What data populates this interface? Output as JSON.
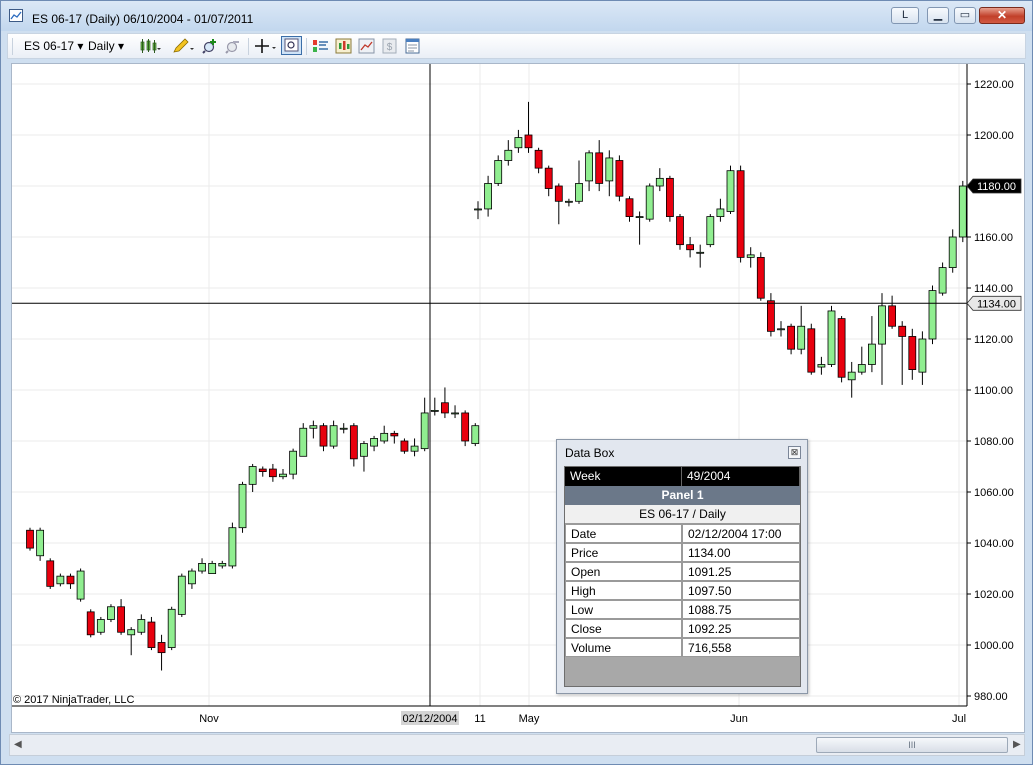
{
  "window": {
    "title": "ES 06-17 (Daily)  06/10/2004 - 01/07/2011",
    "caption_buttons": {
      "link": "L",
      "minimize": "▁",
      "maximize": "▭",
      "close": "✕"
    }
  },
  "toolbar": {
    "instrument": "ES 06-17",
    "interval": "Daily",
    "dropdown_arrow": "▾"
  },
  "chart": {
    "copyright": "© 2017 NinjaTrader, LLC",
    "price_badges": {
      "last": "1180.00",
      "crosshair": "1134.00"
    },
    "time_labels": [
      {
        "text": "Nov",
        "hilite": false
      },
      {
        "text": "02/12/2004",
        "hilite": true
      },
      {
        "text": "11",
        "hilite": false
      },
      {
        "text": "May",
        "hilite": false
      },
      {
        "text": "Jun",
        "hilite": false
      },
      {
        "text": "Jul",
        "hilite": false
      }
    ]
  },
  "chart_data": {
    "type": "candlestick",
    "ylim": [
      972,
      1228
    ],
    "price_ticks": [
      "1220.00",
      "1200.00",
      "1180.00",
      "1160.00",
      "1140.00",
      "1120.00",
      "1100.00",
      "1080.00",
      "1060.00",
      "1040.00",
      "1020.00",
      "1000.00",
      "980.00"
    ],
    "colors": {
      "up": "#90ee90",
      "down": "#e8000e",
      "outline": "#000000",
      "crosshair": "#000000"
    },
    "candles": [
      [
        1045,
        1038,
        1046,
        1037
      ],
      [
        1035,
        1045,
        1046,
        1033
      ],
      [
        1033,
        1023,
        1034,
        1022
      ],
      [
        1024,
        1027,
        1028,
        1023
      ],
      [
        1027,
        1024,
        1028,
        1022
      ],
      [
        1018,
        1029,
        1030,
        1017
      ],
      [
        1013,
        1004,
        1014,
        1003
      ],
      [
        1005,
        1010,
        1011,
        1004
      ],
      [
        1010,
        1015,
        1016,
        1009
      ],
      [
        1015,
        1005,
        1018,
        1004
      ],
      [
        1004,
        1006,
        1007,
        996
      ],
      [
        1005,
        1010,
        1012,
        1004
      ],
      [
        1009,
        999,
        1011,
        998
      ],
      [
        1001,
        997,
        1004,
        990
      ],
      [
        999,
        1014,
        1015,
        998
      ],
      [
        1012,
        1027,
        1028,
        1011
      ],
      [
        1024,
        1029,
        1030,
        1022
      ],
      [
        1029,
        1032,
        1034,
        1028
      ],
      [
        1028,
        1032,
        1033,
        1029
      ],
      [
        1031,
        1032,
        1033,
        1030
      ],
      [
        1031,
        1046,
        1048,
        1030
      ],
      [
        1046,
        1063,
        1064,
        1044
      ],
      [
        1063,
        1070,
        1071,
        1060
      ],
      [
        1069,
        1068,
        1070,
        1066
      ],
      [
        1069,
        1066,
        1071,
        1064
      ],
      [
        1066,
        1067,
        1069,
        1065
      ],
      [
        1067,
        1076,
        1077,
        1065
      ],
      [
        1074,
        1085,
        1087,
        1074
      ],
      [
        1085,
        1086,
        1088,
        1081
      ],
      [
        1086,
        1078,
        1087,
        1076
      ],
      [
        1078,
        1086,
        1088,
        1077
      ],
      [
        1085,
        1085,
        1087,
        1083
      ],
      [
        1086,
        1073,
        1087,
        1070
      ],
      [
        1074,
        1079,
        1080,
        1068
      ],
      [
        1078,
        1081,
        1082,
        1076
      ],
      [
        1080,
        1083,
        1086,
        1079
      ],
      [
        1083,
        1082,
        1084,
        1079
      ],
      [
        1080,
        1076,
        1081,
        1075
      ],
      [
        1076,
        1078,
        1081,
        1074
      ],
      [
        1077,
        1091,
        1097,
        1076
      ],
      [
        1092,
        1092,
        1097,
        1090
      ],
      [
        1095,
        1091,
        1101,
        1089
      ],
      [
        1091,
        1091,
        1094,
        1089
      ],
      [
        1091,
        1080,
        1092,
        1078
      ],
      [
        1079,
        1086,
        1087,
        1078
      ],
      [
        1171,
        1171,
        1174,
        1167
      ],
      [
        1171,
        1181,
        1184,
        1168
      ],
      [
        1181,
        1190,
        1192,
        1180
      ],
      [
        1190,
        1194,
        1198,
        1188
      ],
      [
        1195,
        1199,
        1202,
        1193
      ],
      [
        1200,
        1195,
        1213,
        1193
      ],
      [
        1194,
        1187,
        1195,
        1185
      ],
      [
        1187,
        1179,
        1188,
        1176
      ],
      [
        1180,
        1174,
        1181,
        1165
      ],
      [
        1174,
        1174,
        1175,
        1172
      ],
      [
        1174,
        1181,
        1190,
        1173
      ],
      [
        1182,
        1193,
        1194,
        1178
      ],
      [
        1193,
        1181,
        1198,
        1178
      ],
      [
        1182,
        1191,
        1194,
        1176
      ],
      [
        1190,
        1176,
        1192,
        1174
      ],
      [
        1175,
        1168,
        1176,
        1166
      ],
      [
        1168,
        1168,
        1170,
        1157
      ],
      [
        1167,
        1180,
        1181,
        1166
      ],
      [
        1180,
        1183,
        1187,
        1178
      ],
      [
        1183,
        1168,
        1184,
        1166
      ],
      [
        1168,
        1157,
        1169,
        1155
      ],
      [
        1157,
        1155,
        1160,
        1152
      ],
      [
        1154,
        1154,
        1157,
        1148
      ],
      [
        1157,
        1168,
        1169,
        1156
      ],
      [
        1168,
        1171,
        1175,
        1166
      ],
      [
        1170,
        1186,
        1188,
        1169
      ],
      [
        1186,
        1152,
        1188,
        1150
      ],
      [
        1152,
        1153,
        1156,
        1148
      ],
      [
        1152,
        1136,
        1154,
        1135
      ],
      [
        1135,
        1123,
        1138,
        1121
      ],
      [
        1124,
        1124,
        1127,
        1121
      ],
      [
        1125,
        1116,
        1126,
        1114
      ],
      [
        1116,
        1125,
        1133,
        1114
      ],
      [
        1124,
        1107,
        1126,
        1106
      ],
      [
        1109,
        1110,
        1113,
        1106
      ],
      [
        1110,
        1131,
        1133,
        1109
      ],
      [
        1128,
        1105,
        1129,
        1103
      ],
      [
        1104,
        1107,
        1111,
        1097
      ],
      [
        1107,
        1110,
        1117,
        1106
      ],
      [
        1110,
        1118,
        1129,
        1107
      ],
      [
        1118,
        1133,
        1138,
        1102
      ],
      [
        1133,
        1125,
        1137,
        1124
      ],
      [
        1125,
        1121,
        1127,
        1102
      ],
      [
        1121,
        1108,
        1124,
        1104
      ],
      [
        1107,
        1120,
        1123,
        1102
      ],
      [
        1120,
        1139,
        1141,
        1118
      ],
      [
        1138,
        1148,
        1150,
        1137
      ],
      [
        1148,
        1160,
        1163,
        1146
      ],
      [
        1160,
        1180,
        1182,
        1158
      ]
    ]
  },
  "databox": {
    "title": "Data Box",
    "close": "⊠",
    "week_label": "Week",
    "week_value": "49/2004",
    "panel": "Panel 1",
    "series": "ES 06-17 / Daily",
    "rows": [
      {
        "label": "Date",
        "value": "02/12/2004 17:00"
      },
      {
        "label": "Price",
        "value": "1134.00"
      },
      {
        "label": "Open",
        "value": "1091.25"
      },
      {
        "label": "High",
        "value": "1097.50"
      },
      {
        "label": "Low",
        "value": "1088.75"
      },
      {
        "label": "Close",
        "value": "1092.25"
      },
      {
        "label": "Volume",
        "value": "716,558"
      }
    ]
  },
  "scrollbar": {
    "left": "◀",
    "right": "▶",
    "grip": "III"
  }
}
